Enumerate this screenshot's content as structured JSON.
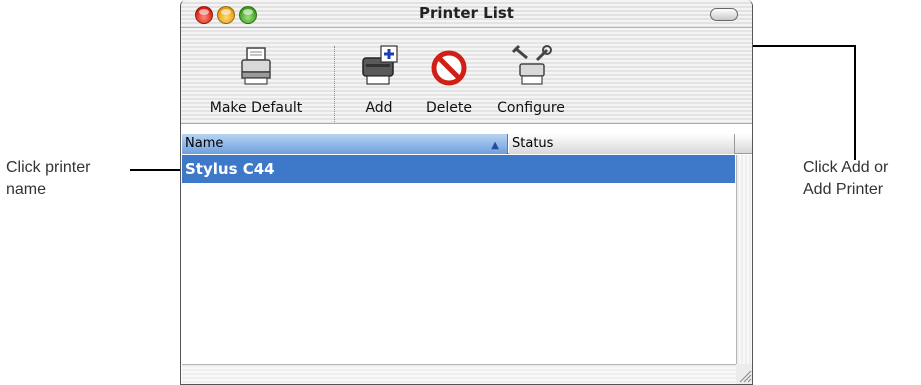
{
  "callouts": {
    "left_line1": "Click printer",
    "left_line2": "name",
    "right_line1": "Click Add or",
    "right_line2": "Add Printer"
  },
  "window": {
    "title": "Printer List"
  },
  "toolbar": {
    "make_default_label": "Make Default",
    "add_label": "Add",
    "delete_label": "Delete",
    "configure_label": "Configure"
  },
  "table": {
    "columns": [
      "Name",
      "Status"
    ],
    "sort_indicator": "▲",
    "rows": [
      {
        "name": "Stylus C44",
        "status": ""
      }
    ]
  },
  "colors": {
    "selection": "#3d78c9",
    "header_active": "#6f9fde"
  }
}
